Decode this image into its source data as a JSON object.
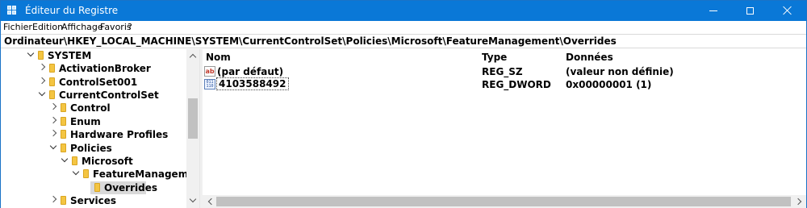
{
  "window": {
    "title": "Éditeur du Registre",
    "minimize_icon": "minimize-icon",
    "maximize_icon": "maximize-icon",
    "close_icon": "close-icon"
  },
  "menu": {
    "items": [
      "Fichier",
      "Edition",
      "Affichage",
      "Favoris",
      "?"
    ]
  },
  "address": {
    "path": "Ordinateur\\HKEY_LOCAL_MACHINE\\SYSTEM\\CurrentControlSet\\Policies\\Microsoft\\FeatureManagement\\Overrides"
  },
  "tree": {
    "items": [
      {
        "label": "SYSTEM",
        "expander": "expanded"
      },
      {
        "label": "ActivationBroker",
        "expander": "collapsed"
      },
      {
        "label": "ControlSet001",
        "expander": "collapsed"
      },
      {
        "label": "CurrentControlSet",
        "expander": "expanded"
      },
      {
        "label": "Control",
        "expander": "collapsed"
      },
      {
        "label": "Enum",
        "expander": "collapsed"
      },
      {
        "label": "Hardware Profiles",
        "expander": "collapsed"
      },
      {
        "label": "Policies",
        "expander": "expanded"
      },
      {
        "label": "Microsoft",
        "expander": "expanded"
      },
      {
        "label": "FeatureManagement",
        "expander": "expanded"
      },
      {
        "label": "Overrides",
        "expander": "none",
        "selected": true
      },
      {
        "label": "Services",
        "expander": "collapsed"
      }
    ]
  },
  "values": {
    "columns": {
      "name": "Nom",
      "type": "Type",
      "data": "Données"
    },
    "rows": [
      {
        "name": "(par défaut)",
        "type": "REG_SZ",
        "data": "(valeur non définie)",
        "icon": "string-value-icon"
      },
      {
        "name": "4103588492",
        "type": "REG_DWORD",
        "data": "0x00000001 (1)",
        "icon": "binary-value-icon"
      }
    ]
  },
  "colors": {
    "titlebar": "#0a78d7",
    "folder": "#f4c542",
    "selection": "#d9d9d9"
  }
}
